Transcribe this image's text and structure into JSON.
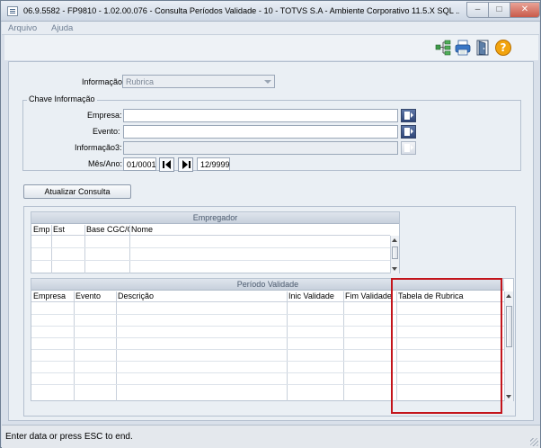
{
  "window": {
    "title": "06.9.5582 - FP9810 - 1.02.00.076 - Consulta Períodos Validade - 10 - TOTVS S.A - Ambiente Corporativo 11.5.X SQL ..."
  },
  "menu": {
    "items": [
      "Arquivo",
      "Ajuda"
    ]
  },
  "toolbar": {
    "icons": [
      "tree-icon",
      "print-icon",
      "exit-door-icon",
      "help-icon"
    ],
    "help_glyph": "?"
  },
  "form": {
    "informacao_label": "Informação:",
    "informacao_value": "Rubrica",
    "group_title": "Chave Informação",
    "empresa_label": "Empresa:",
    "empresa_value": "",
    "evento_label": "Evento:",
    "evento_value": "",
    "informacao3_label": "Informação3:",
    "informacao3_value": "",
    "mesano_label": "Mês/Ano:",
    "mesano_start": "01/0001",
    "mesano_end": "12/9999",
    "update_button": "Atualizar Consulta"
  },
  "grid_empregador": {
    "caption": "Empregador",
    "columns": [
      "Emp",
      "Est",
      "Base CGC/CPF",
      "Nome"
    ]
  },
  "grid_periodo": {
    "caption": "Período Validade",
    "columns": [
      "Empresa",
      "Evento",
      "Descrição",
      "Inic Validade",
      "Fim Validade",
      "Tabela de Rubrica"
    ]
  },
  "highlight": {
    "color": "#c3141b",
    "target": "Tabela de Rubrica"
  },
  "status": {
    "text": "Enter data or press ESC to end."
  },
  "colors": {
    "title_bar": "#dbe3ed",
    "panel": "#eaeff4",
    "close_button": "#c85a4a",
    "lookup_button": "#2e4577"
  }
}
